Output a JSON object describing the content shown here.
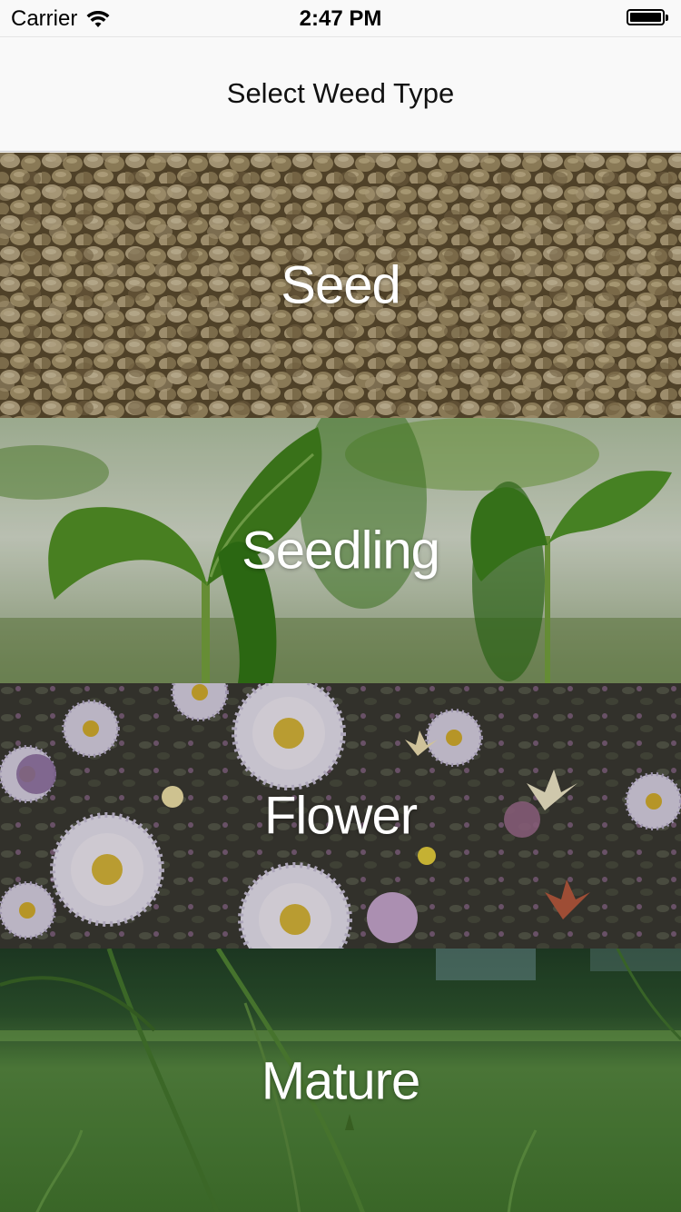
{
  "status_bar": {
    "carrier": "Carrier",
    "time": "2:47 PM",
    "wifi_icon": "wifi-icon",
    "battery_icon": "battery-full-icon"
  },
  "nav": {
    "title": "Select Weed Type"
  },
  "tiles": [
    {
      "label": "Seed",
      "image": "hemp-seeds-photo"
    },
    {
      "label": "Seedling",
      "image": "green-sprout-photo"
    },
    {
      "label": "Flower",
      "image": "purple-white-asters-photo"
    },
    {
      "label": "Mature",
      "image": "tall-grass-meadow-photo"
    }
  ]
}
